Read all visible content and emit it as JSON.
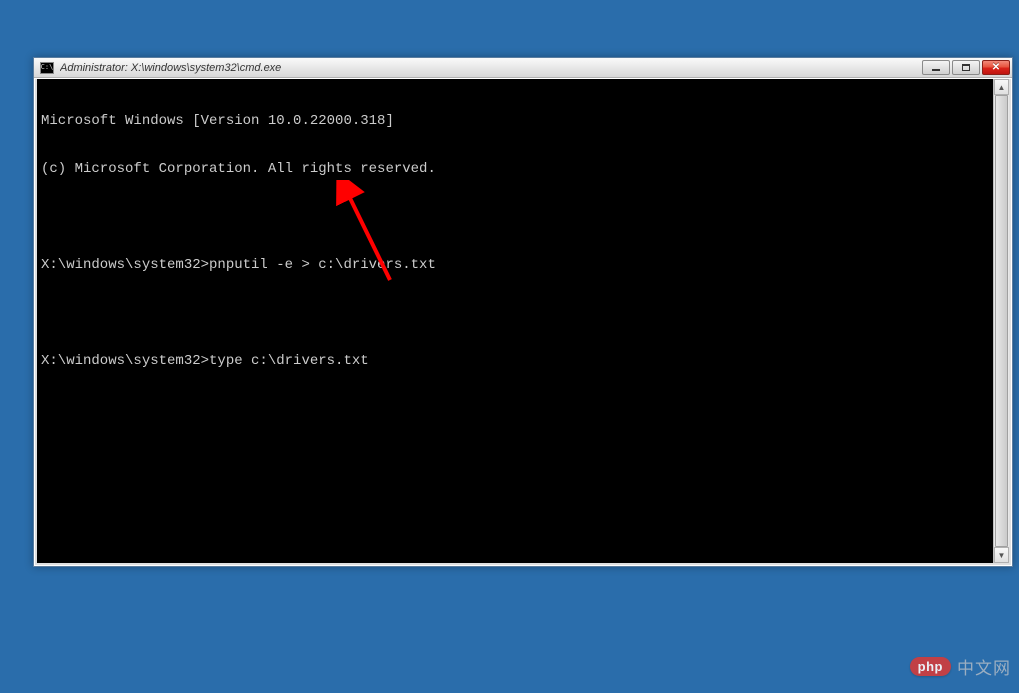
{
  "window": {
    "title": "Administrator: X:\\windows\\system32\\cmd.exe",
    "icon_label": "C:\\"
  },
  "terminal": {
    "lines": [
      "Microsoft Windows [Version 10.0.22000.318]",
      "(c) Microsoft Corporation. All rights reserved.",
      "",
      "X:\\windows\\system32>pnputil -e > c:\\drivers.txt",
      "",
      "X:\\windows\\system32>type c:\\drivers.txt"
    ]
  },
  "watermark": {
    "badge": "php",
    "text": "中文网"
  }
}
